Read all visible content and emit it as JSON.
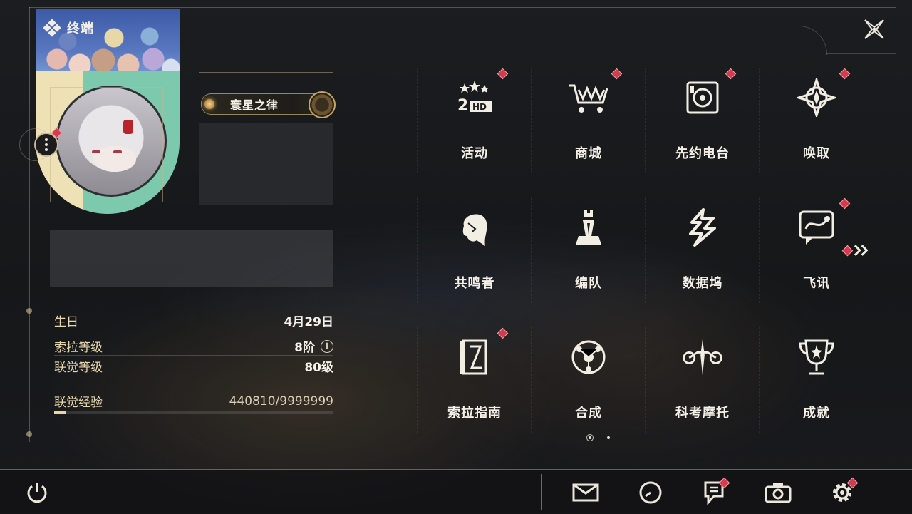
{
  "header": {
    "title": "终端"
  },
  "profile": {
    "name": "寰星之律",
    "stats": [
      {
        "label": "生日",
        "value": "4月29日"
      },
      {
        "label": "索拉等级",
        "value": "8阶"
      },
      {
        "label": "联觉等级",
        "value": "80级"
      },
      {
        "label": "联觉经验",
        "value": "440810/9999999"
      }
    ],
    "exp_progress": 0.044
  },
  "menu": {
    "items": [
      {
        "label": "活动",
        "icon": "2hd-event-icon",
        "badge": true
      },
      {
        "label": "商城",
        "icon": "shop-cart-icon",
        "badge": true
      },
      {
        "label": "先约电台",
        "icon": "radio-icon",
        "badge": true
      },
      {
        "label": "唤取",
        "icon": "summon-compass-icon",
        "badge": true
      },
      {
        "label": "共鸣者",
        "icon": "resonator-head-icon",
        "badge": false
      },
      {
        "label": "编队",
        "icon": "chess-team-icon",
        "badge": false
      },
      {
        "label": "数据坞",
        "icon": "data-bank-icon",
        "badge": false
      },
      {
        "label": "飞讯",
        "icon": "chat-message-icon",
        "badge": true
      },
      {
        "label": "索拉指南",
        "icon": "guide-book-icon",
        "badge": true
      },
      {
        "label": "合成",
        "icon": "synthesis-icon",
        "badge": false
      },
      {
        "label": "科考摩托",
        "icon": "motorbike-icon",
        "badge": false
      },
      {
        "label": "成就",
        "icon": "trophy-icon",
        "badge": false
      }
    ],
    "page_count": 2,
    "current_page": 1
  },
  "bottom_bar": {
    "buttons": [
      "mail-icon",
      "clock-icon",
      "notice-icon",
      "camera-icon",
      "settings-icon"
    ]
  },
  "colors": {
    "badge": "#d43b4e",
    "accent": "#e8d7ae",
    "frame": "#c8b996"
  }
}
